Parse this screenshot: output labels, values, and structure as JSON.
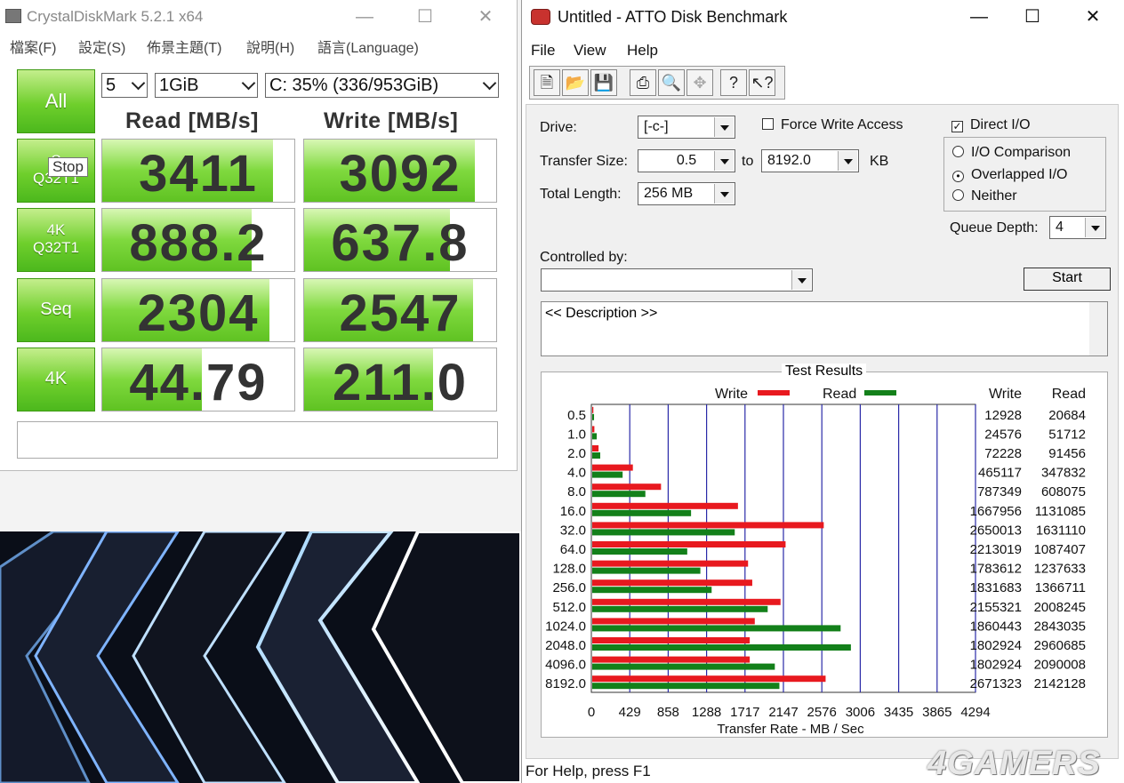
{
  "cdm": {
    "title": "CrystalDiskMark 5.2.1 x64",
    "menu": [
      "檔案(F)",
      "設定(S)",
      "佈景主題(T)",
      "說明(H)",
      "語言(Language)"
    ],
    "all_label": "All",
    "count": "5",
    "size": "1GiB",
    "drive": "C: 35% (336/953GiB)",
    "read_header": "Read [MB/s]",
    "write_header": "Write [MB/s]",
    "tooltip": "Stop",
    "rows": [
      {
        "label1": "S",
        "label2": "Q32T1",
        "read": "3411",
        "write": "3092",
        "read_frac": 0.89,
        "write_frac": 0.89
      },
      {
        "label1": "4K",
        "label2": "Q32T1",
        "read": "888.2",
        "write": "637.8",
        "read_frac": 0.78,
        "write_frac": 0.76
      },
      {
        "label1": "Seq",
        "label2": "",
        "read": "2304",
        "write": "2547",
        "read_frac": 0.87,
        "write_frac": 0.88
      },
      {
        "label1": "4K",
        "label2": "",
        "read": "44.79",
        "write": "211.0",
        "read_frac": 0.52,
        "write_frac": 0.67
      }
    ]
  },
  "atto": {
    "title": "Untitled - ATTO Disk Benchmark",
    "menu": [
      "File",
      "View",
      "Help"
    ],
    "drive_label": "Drive:",
    "drive_value": "[-c-]",
    "force_write": "Force Write Access",
    "direct_io": "Direct I/O",
    "transfer_label": "Transfer Size:",
    "transfer_from": "0.5",
    "to_label": "to",
    "transfer_to": "8192.0",
    "kb_label": "KB",
    "total_label": "Total Length:",
    "total_value": "256 MB",
    "io_comparison": "I/O Comparison",
    "overlapped": "Overlapped I/O",
    "neither": "Neither",
    "queue_label": "Queue Depth:",
    "queue_value": "4",
    "controlled_label": "Controlled by:",
    "start": "Start",
    "description": "<< Description >>",
    "results_title": "Test Results",
    "status": "For Help, press F1"
  },
  "chart_data": {
    "type": "bar",
    "title": "Test Results",
    "xlabel": "Transfer Rate - MB / Sec",
    "xlim": [
      0,
      4294
    ],
    "xticks": [
      "0",
      "429",
      "858",
      "1288",
      "1717",
      "2147",
      "2576",
      "3006",
      "3435",
      "3865",
      "4294"
    ],
    "categories": [
      "0.5",
      "1.0",
      "2.0",
      "4.0",
      "8.0",
      "16.0",
      "32.0",
      "64.0",
      "128.0",
      "256.0",
      "512.0",
      "1024.0",
      "2048.0",
      "4096.0",
      "8192.0"
    ],
    "series": [
      {
        "name": "Write",
        "color": "#e8191f",
        "values": [
          12928,
          24576,
          72228,
          465117,
          787349,
          1667956,
          2650013,
          2213019,
          1783612,
          1831683,
          2155321,
          1860443,
          1802924,
          1802924,
          2671323
        ]
      },
      {
        "name": "Read",
        "color": "#13801a",
        "values": [
          20684,
          51712,
          91456,
          347832,
          608075,
          1131085,
          1631110,
          1087407,
          1237633,
          1366711,
          2008245,
          2843035,
          2960685,
          2090008,
          2142128
        ]
      }
    ],
    "col_headers": [
      "Write",
      "Read"
    ]
  },
  "watermark": "4GAMERS"
}
